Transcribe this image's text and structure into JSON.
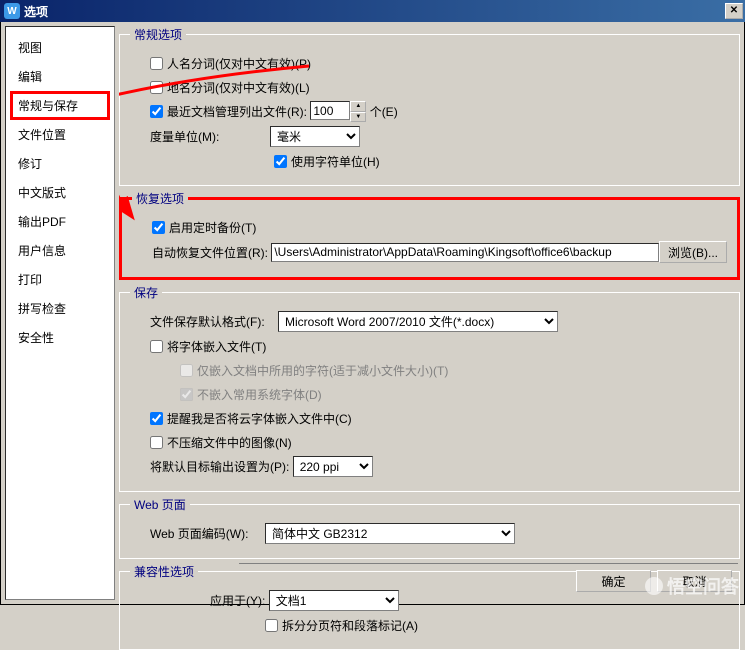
{
  "window": {
    "title": "选项"
  },
  "sidebar": {
    "items": [
      {
        "label": "视图"
      },
      {
        "label": "编辑"
      },
      {
        "label": "常规与保存"
      },
      {
        "label": "文件位置"
      },
      {
        "label": "修订"
      },
      {
        "label": "中文版式"
      },
      {
        "label": "输出PDF"
      },
      {
        "label": "用户信息"
      },
      {
        "label": "打印"
      },
      {
        "label": "拼写检查"
      },
      {
        "label": "安全性"
      }
    ]
  },
  "general": {
    "legend": "常规选项",
    "name_split": "人名分词(仅对中文有效)(P)",
    "place_split": "地名分词(仅对中文有效)(L)",
    "recent_docs_label": "最近文档管理列出文件(R):",
    "recent_docs_value": "100",
    "recent_docs_unit": "个(E)",
    "unit_label": "度量单位(M):",
    "unit_value": "毫米",
    "use_char_unit": "使用字符单位(H)"
  },
  "recovery": {
    "legend": "恢复选项",
    "enable_backup": "启用定时备份(T)",
    "path_label": "自动恢复文件位置(R):",
    "path_value": "\\Users\\Administrator\\AppData\\Roaming\\Kingsoft\\office6\\backup",
    "browse": "浏览(B)..."
  },
  "save": {
    "legend": "保存",
    "default_fmt_label": "文件保存默认格式(F):",
    "default_fmt_value": "Microsoft Word 2007/2010 文件(*.docx)",
    "embed_font": "将字体嵌入文件(T)",
    "embed_used_only": "仅嵌入文档中所用的字符(适于减小文件大小)(T)",
    "no_embed_sys": "不嵌入常用系统字体(D)",
    "warn_cloud_font": "提醒我是否将云字体嵌入文件中(C)",
    "no_compress_img": "不压缩文件中的图像(N)",
    "default_res_label": "将默认目标输出设置为(P):",
    "default_res_value": "220 ppi"
  },
  "web": {
    "legend": "Web 页面",
    "encoding_label": "Web 页面编码(W):",
    "encoding_value": "简体中文 GB2312"
  },
  "compat": {
    "legend": "兼容性选项",
    "apply_label": "应用于(Y):",
    "apply_value": "文档1",
    "split_page": "拆分分页符和段落标记(A)"
  },
  "buttons": {
    "ok": "确定",
    "cancel": "取消"
  },
  "watermark": "悟空问答"
}
